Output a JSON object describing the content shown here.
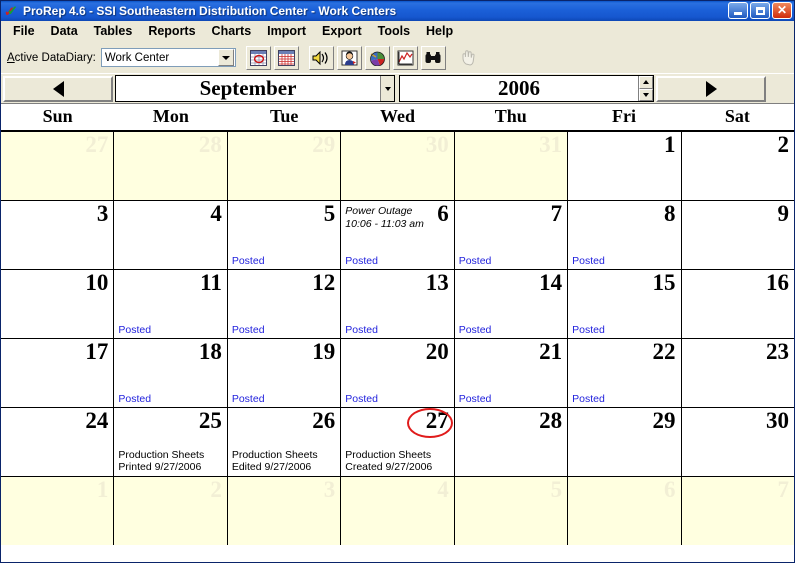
{
  "window": {
    "title": "ProRep 4.6 - SSI Southeastern Distribution Center - Work Centers",
    "icon": "prorep-checks-icon",
    "minimize_label": "Minimize",
    "maximize_label": "Maximize",
    "close_label": "Close"
  },
  "menu": {
    "items": [
      {
        "label": "File"
      },
      {
        "label": "Data"
      },
      {
        "label": "Tables"
      },
      {
        "label": "Reports"
      },
      {
        "label": "Charts"
      },
      {
        "label": "Import"
      },
      {
        "label": "Export"
      },
      {
        "label": "Tools"
      },
      {
        "label": "Help"
      }
    ]
  },
  "toolbar": {
    "datadiary_label_prefix": "A",
    "datadiary_label_rest": "ctive DataDiary:",
    "datadiary_value": "Work Center",
    "datadiary_placeholder": "Work Center",
    "buttons": [
      {
        "name": "calendar-view-button",
        "tooltip": "Calendar View"
      },
      {
        "name": "grid-view-button",
        "tooltip": "Grid View"
      },
      {
        "name": "speaker-button",
        "tooltip": "Sound"
      },
      {
        "name": "contact-button",
        "tooltip": "Contact"
      },
      {
        "name": "pie-chart-button",
        "tooltip": "Pie Chart"
      },
      {
        "name": "line-chart-button",
        "tooltip": "Line Chart"
      },
      {
        "name": "find-button",
        "tooltip": "Find"
      },
      {
        "name": "pointer-button",
        "tooltip": "Select",
        "disabled": true
      }
    ]
  },
  "nav": {
    "prev_label": "Previous",
    "next_label": "Next",
    "month": "September",
    "year": "2006",
    "year_up_label": "Increase year",
    "year_down_label": "Decrease year"
  },
  "calendar": {
    "day_headers": [
      "Sun",
      "Mon",
      "Tue",
      "Wed",
      "Thu",
      "Fri",
      "Sat"
    ],
    "colors": {
      "other_month_bg": "#FFFFE0",
      "current_month_bg": "#FFFFFF",
      "posted_text": "#2222DD",
      "highlight_circle": "#E01B1B",
      "grid_line": "#000000"
    },
    "weeks": [
      [
        {
          "day": "27",
          "other": true
        },
        {
          "day": "28",
          "other": true
        },
        {
          "day": "29",
          "other": true
        },
        {
          "day": "30",
          "other": true
        },
        {
          "day": "31",
          "other": true
        },
        {
          "day": "1",
          "other": false
        },
        {
          "day": "2",
          "other": false
        }
      ],
      [
        {
          "day": "3",
          "other": false
        },
        {
          "day": "4",
          "other": false
        },
        {
          "day": "5",
          "other": false,
          "posted": "Posted"
        },
        {
          "day": "6",
          "other": false,
          "event": "Power Outage\n10:06 - 11:03 am",
          "posted": "Posted"
        },
        {
          "day": "7",
          "other": false,
          "posted": "Posted"
        },
        {
          "day": "8",
          "other": false,
          "posted": "Posted"
        },
        {
          "day": "9",
          "other": false
        }
      ],
      [
        {
          "day": "10",
          "other": false
        },
        {
          "day": "11",
          "other": false,
          "posted": "Posted"
        },
        {
          "day": "12",
          "other": false,
          "posted": "Posted"
        },
        {
          "day": "13",
          "other": false,
          "posted": "Posted"
        },
        {
          "day": "14",
          "other": false,
          "posted": "Posted"
        },
        {
          "day": "15",
          "other": false,
          "posted": "Posted"
        },
        {
          "day": "16",
          "other": false
        }
      ],
      [
        {
          "day": "17",
          "other": false
        },
        {
          "day": "18",
          "other": false,
          "posted": "Posted"
        },
        {
          "day": "19",
          "other": false,
          "posted": "Posted"
        },
        {
          "day": "20",
          "other": false,
          "posted": "Posted"
        },
        {
          "day": "21",
          "other": false,
          "posted": "Posted"
        },
        {
          "day": "22",
          "other": false,
          "posted": "Posted"
        },
        {
          "day": "23",
          "other": false
        }
      ],
      [
        {
          "day": "24",
          "other": false
        },
        {
          "day": "25",
          "other": false,
          "note": "Production Sheets\nPrinted 9/27/2006"
        },
        {
          "day": "26",
          "other": false,
          "note": "Production Sheets\nEdited 9/27/2006"
        },
        {
          "day": "27",
          "other": false,
          "note": "Production Sheets\nCreated 9/27/2006",
          "circled": true
        },
        {
          "day": "28",
          "other": false
        },
        {
          "day": "29",
          "other": false
        },
        {
          "day": "30",
          "other": false
        }
      ],
      [
        {
          "day": "1",
          "other": true
        },
        {
          "day": "2",
          "other": true
        },
        {
          "day": "3",
          "other": true
        },
        {
          "day": "4",
          "other": true
        },
        {
          "day": "5",
          "other": true
        },
        {
          "day": "6",
          "other": true
        },
        {
          "day": "7",
          "other": true
        }
      ]
    ]
  }
}
